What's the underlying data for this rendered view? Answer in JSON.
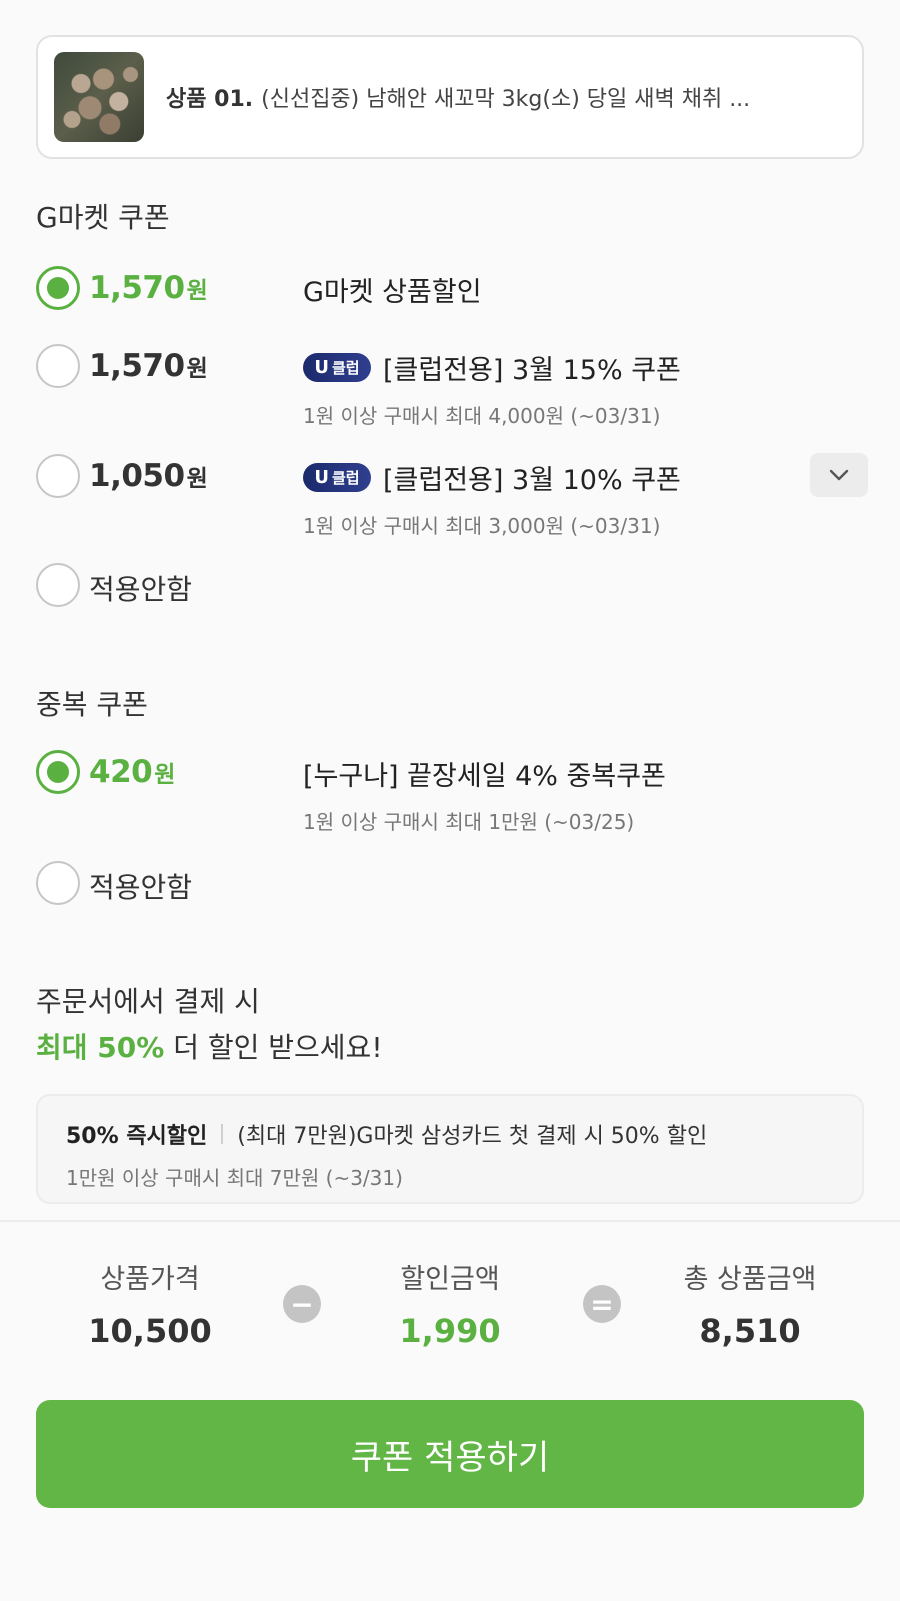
{
  "product": {
    "index_label": "상품 01.",
    "name": "(신선집중) 남해안 새꼬막 3kg(소) 당일 새벽 채취 ..."
  },
  "gmarket_coupon": {
    "title": "G마켓 쿠폰",
    "options": [
      {
        "amount": "1,570",
        "won": "원",
        "selected": true,
        "title": "G마켓 상품할인",
        "sub": ""
      },
      {
        "amount": "1,570",
        "won": "원",
        "selected": false,
        "badge": "클럽",
        "title": "[클럽전용] 3월 15% 쿠폰",
        "sub": "1원 이상 구매시 최대 4,000원 (~03/31)"
      },
      {
        "amount": "1,050",
        "won": "원",
        "selected": false,
        "badge": "클럽",
        "title": "[클럽전용] 3월 10% 쿠폰",
        "sub": "1원 이상 구매시 최대 3,000원 (~03/31)"
      }
    ],
    "none_label": "적용안함"
  },
  "stack_coupon": {
    "title": "중복 쿠폰",
    "options": [
      {
        "amount": "420",
        "won": "원",
        "selected": true,
        "title": "[누구나] 끝장세일 4% 중복쿠폰",
        "sub": "1원 이상 구매시 최대 1만원 (~03/25)"
      }
    ],
    "none_label": "적용안함"
  },
  "promo": {
    "line1": "주문서에서 결제 시",
    "line2_highlight": "최대 50%",
    "line2_rest": " 더 할인 받으세요!"
  },
  "card_promo": {
    "tag": "50% 즉시할인",
    "title": "(최대 7만원)G마켓 삼성카드 첫 결제 시 50% 할인",
    "sub": "1만원 이상 구매시 최대 7만원 (~3/31)"
  },
  "summary": {
    "price_label": "상품가격",
    "price_value": "10,500",
    "minus": "−",
    "discount_label": "할인금액",
    "discount_value": "1,990",
    "equals": "=",
    "total_label": "총 상품금액",
    "total_value": "8,510"
  },
  "apply_button": "쿠폰 적용하기",
  "colors": {
    "accent": "#5ab142",
    "button": "#62b646",
    "club_badge": "#1b2a6b"
  }
}
